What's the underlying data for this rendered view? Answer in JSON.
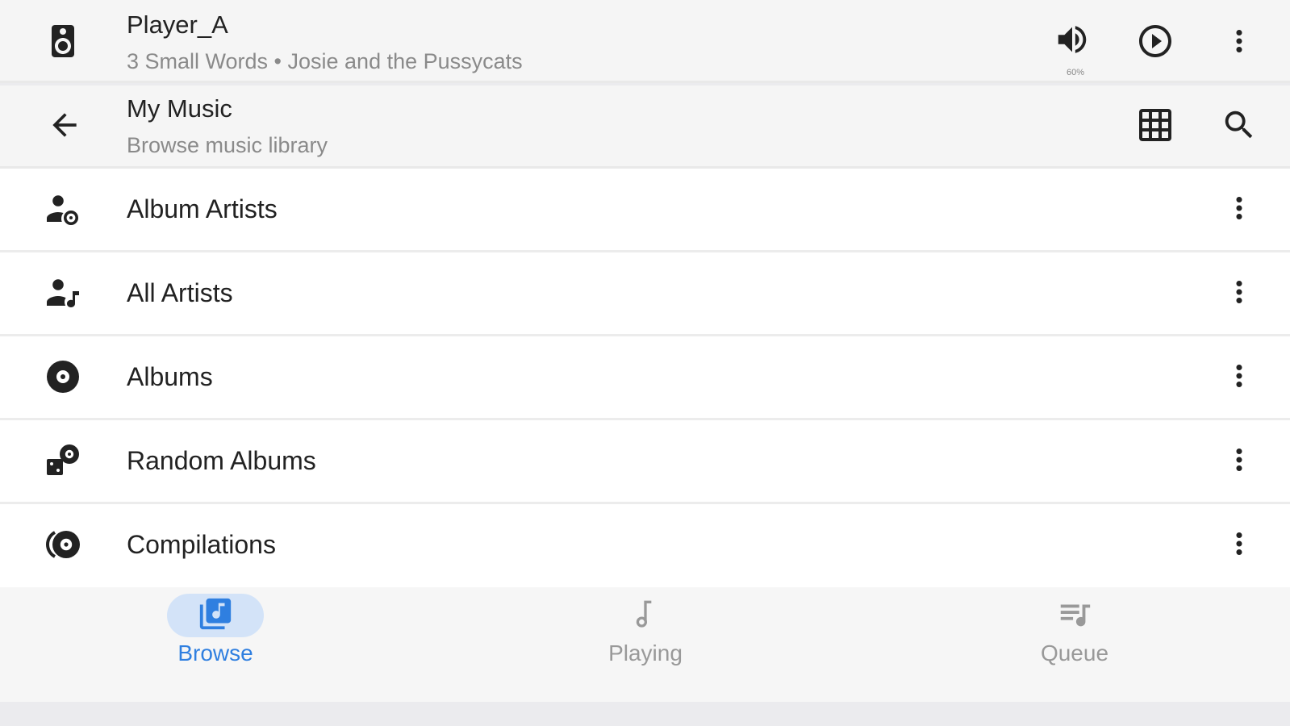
{
  "player": {
    "name": "Player_A",
    "now_playing": "3 Small Words • Josie and the Pussycats",
    "volume_label": "60%",
    "icons": {
      "device": "speaker-icon",
      "volume": "volume-icon",
      "play": "play-circle-icon",
      "menu": "more-vert-icon"
    }
  },
  "header": {
    "title": "My Music",
    "subtitle": "Browse music library",
    "icons": {
      "back": "arrow-back-icon",
      "grid": "grid-view-icon",
      "search": "search-icon"
    }
  },
  "library": {
    "items": [
      {
        "label": "Album Artists",
        "icon": "album-artist-icon"
      },
      {
        "label": "All Artists",
        "icon": "artist-icon"
      },
      {
        "label": "Albums",
        "icon": "album-icon"
      },
      {
        "label": "Random Albums",
        "icon": "random-albums-icon"
      },
      {
        "label": "Compilations",
        "icon": "compilations-icon"
      }
    ]
  },
  "bottom_nav": {
    "tabs": [
      {
        "label": "Browse",
        "icon": "library-music-icon",
        "active": true
      },
      {
        "label": "Playing",
        "icon": "music-note-icon",
        "active": false
      },
      {
        "label": "Queue",
        "icon": "queue-music-icon",
        "active": false
      }
    ]
  },
  "colors": {
    "accent": "#2f7fe0",
    "active_pill": "#d3e3f8",
    "icon": "#222222",
    "inactive": "#999999",
    "bar_bg": "#f5f5f5"
  }
}
